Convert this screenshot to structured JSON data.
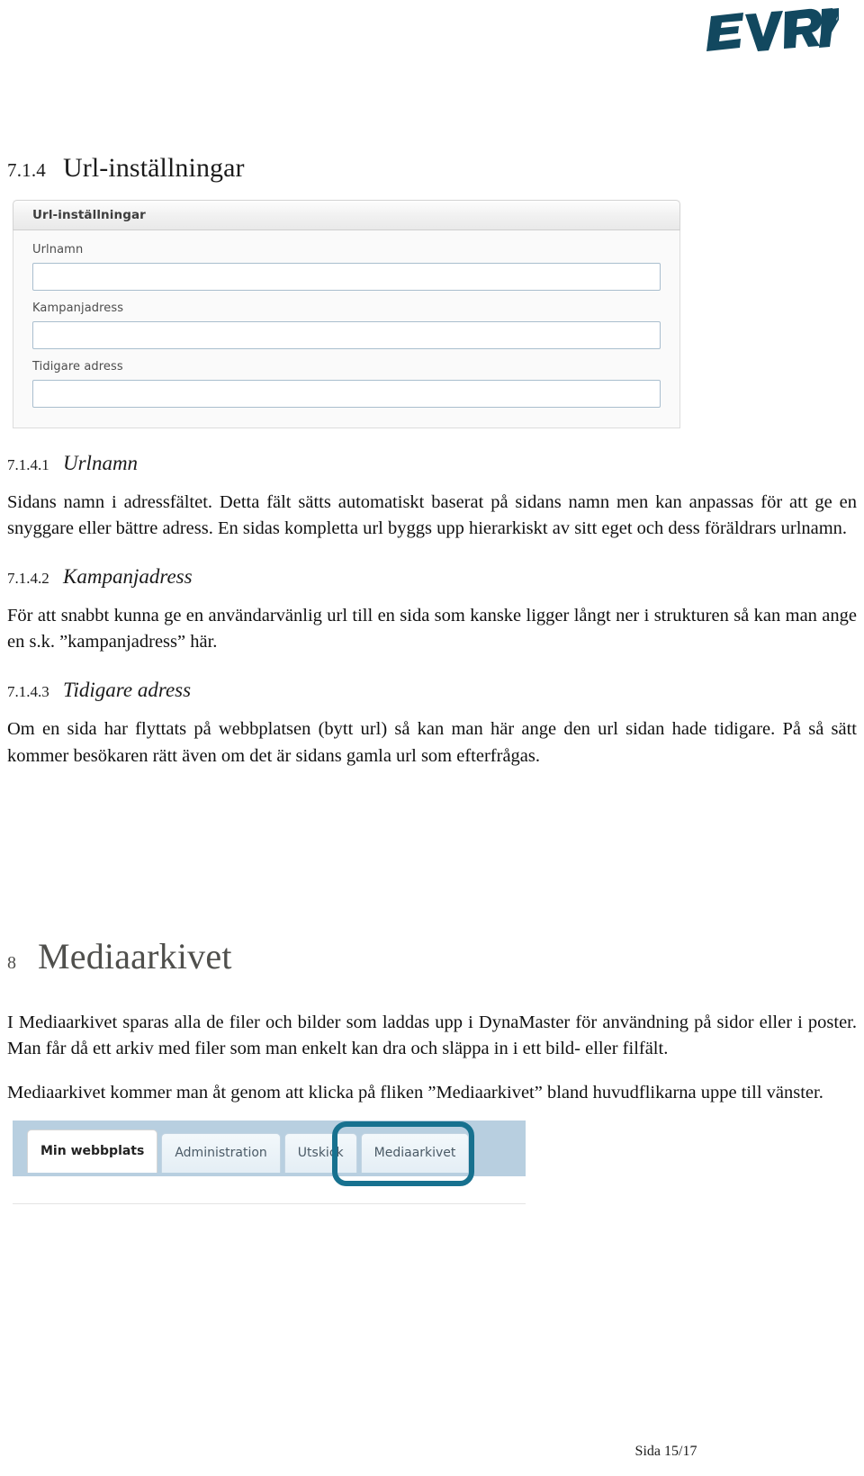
{
  "brand": {
    "name": "EVRY",
    "color": "#12485f"
  },
  "heading_main": {
    "number": "7.1.4",
    "title": "Url-inställningar"
  },
  "form_panel": {
    "header_title": "Url-inställningar",
    "fields": [
      {
        "label": "Urlnamn",
        "value": "",
        "placeholder": ""
      },
      {
        "label": "Kampanjadress",
        "value": "",
        "placeholder": ""
      },
      {
        "label": "Tidigare adress",
        "value": "",
        "placeholder": ""
      }
    ]
  },
  "sections": [
    {
      "number": "7.1.4.1",
      "title": "Urlnamn",
      "body": "Sidans namn i adressfältet. Detta fält sätts automatiskt baserat på sidans namn men kan anpassas för att ge en snyggare eller bättre adress. En sidas kompletta url byggs upp hierarkiskt av sitt eget och dess föräldrars urlnamn."
    },
    {
      "number": "7.1.4.2",
      "title": "Kampanjadress",
      "body": "För att snabbt kunna ge en användarvänlig url till en sida som kanske ligger långt ner i strukturen så kan man ange en s.k. ”kampanjadress” här."
    },
    {
      "number": "7.1.4.3",
      "title": "Tidigare adress",
      "body": "Om en sida har flyttats på webbplatsen (bytt url) så kan man här ange den url sidan hade tidigare. På så sätt kommer besökaren rätt även om det är sidans gamla url som efterfrågas."
    }
  ],
  "chapter": {
    "number": "8",
    "title": "Mediaarkivet",
    "paragraph_1": "I Mediaarkivet sparas alla de filer och bilder som laddas upp i DynaMaster för användning på sidor eller i poster. Man får då ett arkiv med filer som man enkelt kan dra och släppa in i ett bild- eller filfält.",
    "paragraph_2": "Mediaarkivet kommer man åt genom att klicka på fliken ”Mediaarkivet” bland huvudflikarna uppe till vänster."
  },
  "tab_screenshot": {
    "tabs": [
      {
        "label": "Min webbplats",
        "active": true
      },
      {
        "label": "Administration",
        "active": false
      },
      {
        "label": "Utskick",
        "active": false
      },
      {
        "label": "Mediaarkivet",
        "active": false
      }
    ],
    "highlight_tab": "Mediaarkivet",
    "highlight_color": "#17718f"
  },
  "footer": {
    "page_label": "Sida 15/17"
  }
}
